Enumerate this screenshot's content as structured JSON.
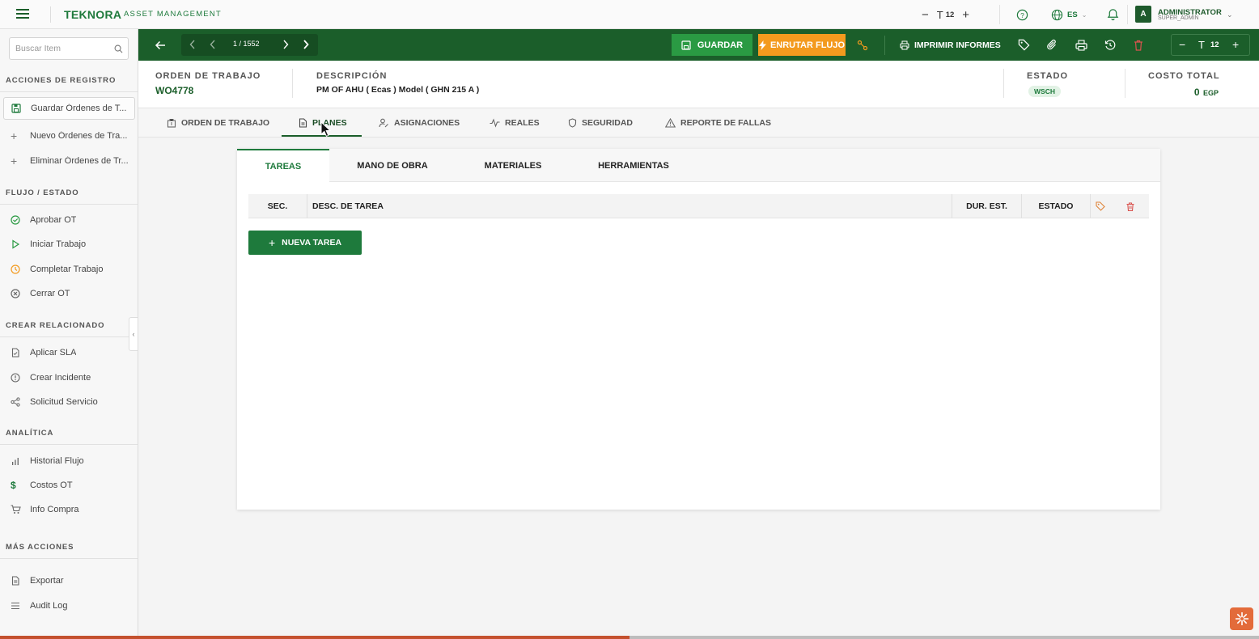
{
  "brand": {
    "logo": "TEKNORA",
    "subtitle": "ASSET MANAGEMENT"
  },
  "topbar": {
    "font_size": "12",
    "language": "ES",
    "user_name": "ADMINISTRATOR",
    "user_role": "SUPER_ADMIN",
    "avatar_letter": "A"
  },
  "sidebar": {
    "search_placeholder": "Buscar Item",
    "sections": {
      "registro": "ACCIONES DE REGISTRO",
      "flujo": "FLUJO / ESTADO",
      "crear": "CREAR RELACIONADO",
      "analitica": "ANALÍTICA",
      "mas": "MÁS ACCIONES"
    },
    "registro_items": [
      "Guardar Órdenes de T...",
      "Nuevo Órdenes de Tra...",
      "Eliminar Órdenes de Tr..."
    ],
    "flujo_items": [
      "Aprobar OT",
      "Iniciar Trabajo",
      "Completar Trabajo",
      "Cerrar OT"
    ],
    "crear_items": [
      "Aplicar SLA",
      "Crear Incidente",
      "Solicitud Servicio"
    ],
    "analitica_items": [
      "Historial Flujo",
      "Costos OT",
      "Info Compra"
    ],
    "mas_items": [
      "Exportar",
      "Audit Log"
    ]
  },
  "actionbar": {
    "pager": "1 / 1552",
    "save": "GUARDAR",
    "route": "ENRUTAR FLUJO",
    "print": "IMPRIMIR INFORMES",
    "font_size": "12"
  },
  "header": {
    "wo_label": "ORDEN DE TRABAJO",
    "wo_value": "WO4778",
    "desc_label": "DESCRIPCIÓN",
    "desc_value": "PM OF AHU   ( Ecas )  Model ( GHN 215 A )",
    "status_label": "ESTADO",
    "status_value": "WSCH",
    "cost_label": "COSTO TOTAL",
    "cost_value": "0",
    "cost_currency": "EGP"
  },
  "tabs": [
    "ORDEN DE TRABAJO",
    "PLANES",
    "ASIGNACIONES",
    "REALES",
    "SEGURIDAD",
    "REPORTE DE FALLAS"
  ],
  "subtabs": [
    "TAREAS",
    "MANO DE OBRA",
    "MATERIALES",
    "HERRAMIENTAS"
  ],
  "table": {
    "columns": [
      "SEC.",
      "DESC. DE TAREA",
      "DUR. EST.",
      "ESTADO"
    ]
  },
  "new_task": "NUEVA TAREA",
  "page_progress": 0.5,
  "colors": {
    "primary": "#1b5e2a",
    "accent": "#1e7a3c",
    "route": "#f39a1e",
    "danger": "#d9534f",
    "fab": "#e36b3a"
  }
}
